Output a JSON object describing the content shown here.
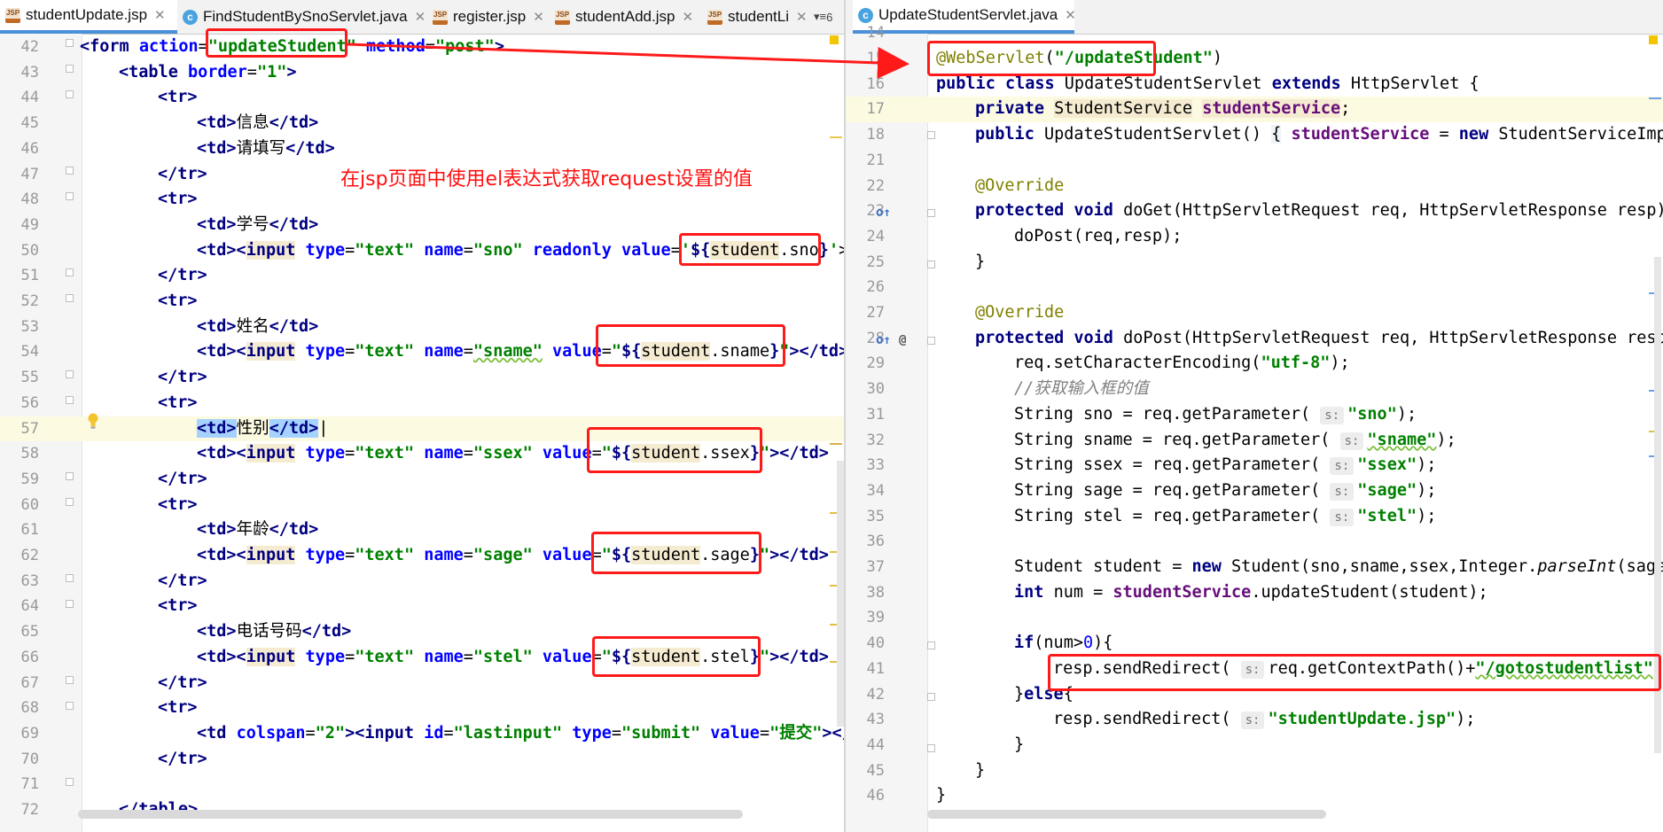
{
  "left": {
    "tabs": [
      {
        "label": "studentUpdate.jsp",
        "type": "jsp",
        "active": true
      },
      {
        "label": "FindStudentBySnoServlet.java",
        "type": "class",
        "active": false
      },
      {
        "label": "register.jsp",
        "type": "jsp",
        "active": false
      },
      {
        "label": "studentAdd.jsp",
        "type": "jsp",
        "active": false
      },
      {
        "label": "studentLi",
        "type": "jsp",
        "active": false
      }
    ],
    "tab_overflow": "6",
    "annotation": "在jsp页面中使用el表达式获取request设置的值"
  },
  "right": {
    "tabs": [
      {
        "label": "UpdateStudentServlet.java",
        "type": "class",
        "active": true
      }
    ]
  },
  "colors": {
    "keyword": "#000080",
    "string": "#008000",
    "field": "#660e7a",
    "annotation": "#808000",
    "comment": "#808080",
    "highlight_box": "#ff1a1a",
    "active_tab_underline": "#4a90d9"
  },
  "icons": {
    "jsp_file": "jsp-file-icon",
    "java_class": "java-class-icon",
    "close": "close-icon",
    "bulb": "lightbulb-icon",
    "override": "override-gutter-icon"
  }
}
